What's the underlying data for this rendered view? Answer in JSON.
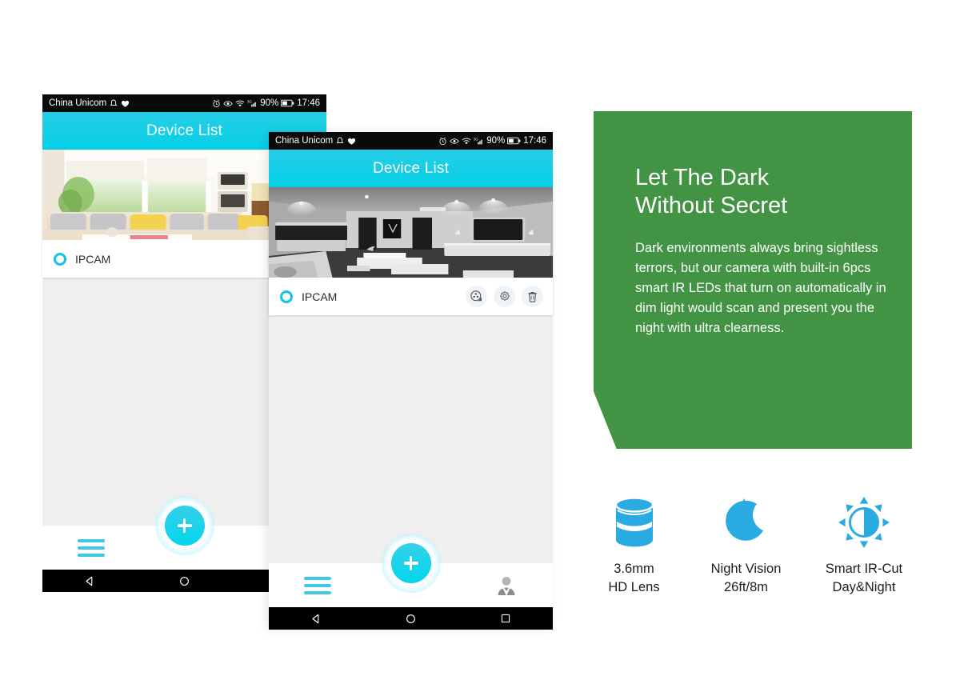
{
  "theme": {
    "cyan": "#04d0e8",
    "green": "#429343",
    "icon_blue": "#29ABE2",
    "status_bg": "#0a0a0a",
    "content_bg": "#efefef"
  },
  "phones": [
    {
      "id": "phone-back",
      "status_bar": {
        "carrier": "China Unicom",
        "battery_percent": "90%",
        "time": "17:46",
        "icons": [
          "bell-icon",
          "heart-icon",
          "alarm-icon",
          "eye-icon",
          "wifi-icon",
          "signal-icon",
          "battery-icon"
        ]
      },
      "app_bar": {
        "title": "Device List"
      },
      "camera": {
        "name": "IPCAM",
        "thumbnail": "bright-living-room-daylight",
        "status_icon": "online-ring-icon",
        "actions": [
          {
            "name": "playback-button",
            "icon": "film-reel-icon"
          },
          {
            "name": "settings-button",
            "icon": "gear-icon"
          }
        ]
      },
      "bottom_bar": {
        "menu": {
          "name": "menu-button",
          "icon": "hamburger-icon"
        },
        "add": {
          "name": "add-device-button",
          "icon": "plus-icon"
        },
        "profile": null
      },
      "android_nav": [
        "back-icon",
        "home-icon",
        "recents-icon"
      ]
    },
    {
      "id": "phone-front",
      "status_bar": {
        "carrier": "China Unicom",
        "battery_percent": "90%",
        "time": "17:46",
        "icons": [
          "bell-icon",
          "heart-icon",
          "alarm-icon",
          "eye-icon",
          "wifi-icon",
          "signal-icon",
          "battery-icon"
        ]
      },
      "app_bar": {
        "title": "Device List"
      },
      "camera": {
        "name": "IPCAM",
        "thumbnail": "night-vision-living-room-grayscale",
        "status_icon": "online-ring-icon",
        "actions": [
          {
            "name": "playback-button",
            "icon": "film-reel-icon"
          },
          {
            "name": "settings-button",
            "icon": "gear-icon"
          },
          {
            "name": "delete-button",
            "icon": "trash-icon"
          }
        ]
      },
      "bottom_bar": {
        "menu": {
          "name": "menu-button",
          "icon": "hamburger-icon"
        },
        "add": {
          "name": "add-device-button",
          "icon": "plus-icon"
        },
        "profile": {
          "name": "profile-button",
          "icon": "person-icon"
        }
      },
      "android_nav": [
        "back-icon",
        "home-icon",
        "recents-icon"
      ]
    }
  ],
  "promo": {
    "heading_line1": "Let The Dark",
    "heading_line2": "Without Secret",
    "body": "Dark environments always bring sightless terrors, but our camera with built-in 6pcs smart IR LEDs that turn on automatically in dim light would scan and present you the night with ultra clearness."
  },
  "features": [
    {
      "icon": "lens-icon",
      "line1": "3.6mm",
      "line2": "HD Lens"
    },
    {
      "icon": "moon-stars-icon",
      "line1": "Night Vision",
      "line2": "26ft/8m"
    },
    {
      "icon": "ir-cut-sun-icon",
      "line1": "Smart IR-Cut",
      "line2": "Day&Night"
    }
  ]
}
